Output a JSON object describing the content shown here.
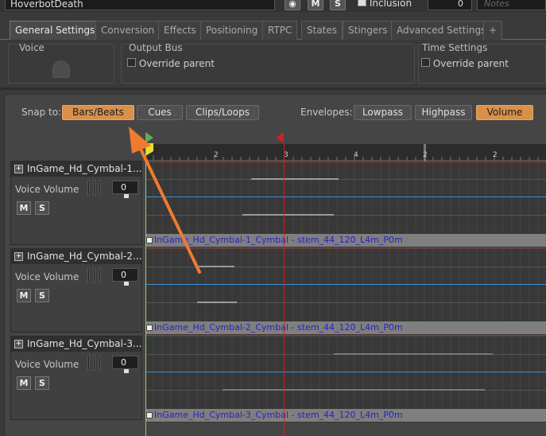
{
  "header": {
    "object_name": "HoverbotDeath",
    "mute_label": "M",
    "solo_label": "S",
    "inclusion_label": "Inclusion",
    "color_value": "0",
    "notes_placeholder": "Notes"
  },
  "tabs": [
    {
      "label": "General Settings",
      "active": true
    },
    {
      "label": "Conversion"
    },
    {
      "label": "Effects"
    },
    {
      "label": "Positioning"
    },
    {
      "label": "RTPC"
    },
    {
      "label": "States"
    },
    {
      "label": "Stingers"
    },
    {
      "label": "Advanced Settings"
    },
    {
      "label": "+"
    }
  ],
  "settings": {
    "voice_title": "Voice",
    "output_bus_title": "Output Bus",
    "output_bus_override": "Override parent",
    "time_settings_title": "Time Settings",
    "time_settings_override": "Override parent"
  },
  "snap": {
    "label": "Snap to:",
    "options": [
      "Bars/Beats",
      "Cues",
      "Clips/Loops"
    ],
    "selected": "Bars/Beats"
  },
  "envelopes": {
    "label": "Envelopes:",
    "options": [
      "Lowpass",
      "Highpass",
      "Volume"
    ],
    "selected": "Volume"
  },
  "ruler": {
    "ticks": [
      "2",
      "3",
      "4",
      "2",
      "2"
    ]
  },
  "tracks": [
    {
      "name": "InGame_Hd_Cymbal-1...",
      "param_label": "Voice Volume",
      "volume": "0",
      "mute": "M",
      "solo": "S",
      "clip_name": "InGame_Hd_Cymbal-1_Cymbal - stem_44_120_L4m_P0m"
    },
    {
      "name": "InGame_Hd_Cymbal-2...",
      "param_label": "Voice Volume",
      "volume": "0",
      "mute": "M",
      "solo": "S",
      "clip_name": "InGame_Hd_Cymbal-2_Cymbal - stem_44_120_L4m_P0m"
    },
    {
      "name": "InGame_Hd_Cymbal-3...",
      "param_label": "Voice Volume",
      "volume": "0",
      "mute": "M",
      "solo": "S",
      "clip_name": "InGame_Hd_Cymbal-3_Cymbal - stem_44_120_L4m_P0m"
    }
  ],
  "colors": {
    "accent_orange": "#d8904a",
    "annotation_arrow": "#f07a30",
    "playhead_red": "#cc2222",
    "envelope_blue": "#3a8fd8",
    "clip_text_blue": "#2424c8",
    "entry_marker_green": "#6aa84f"
  },
  "annotation": {
    "type": "arrow",
    "points_to": "snap-bars-beats-button"
  }
}
